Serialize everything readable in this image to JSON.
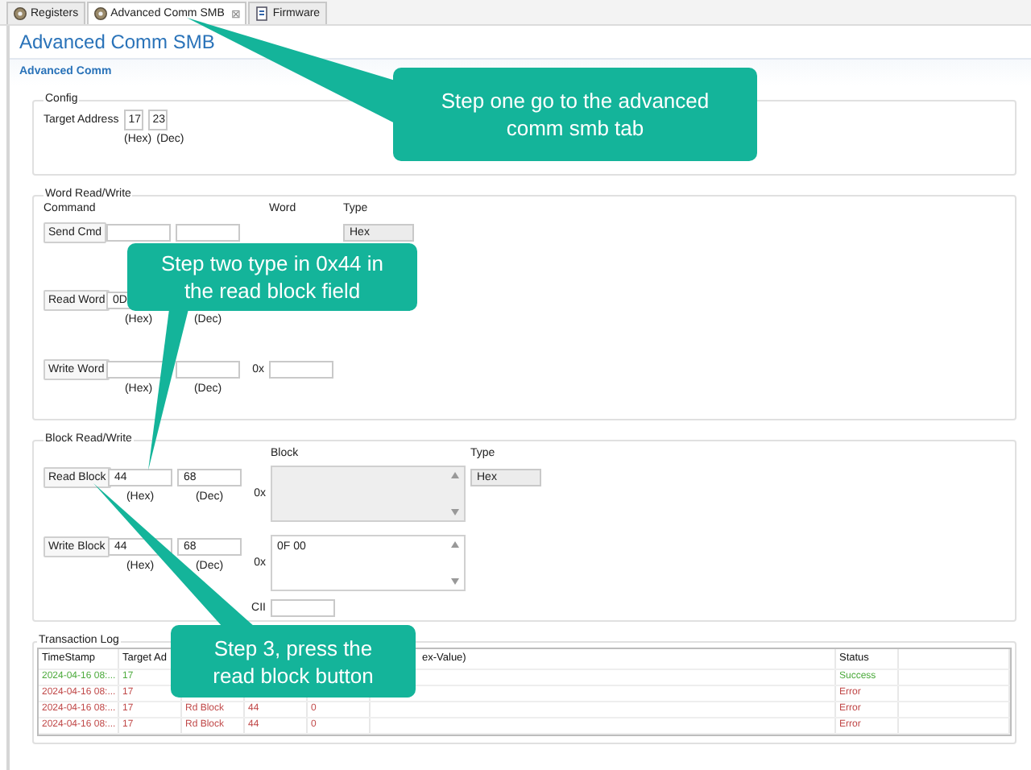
{
  "tabs": [
    {
      "label": "Registers",
      "selected": false
    },
    {
      "label": "Advanced Comm SMB",
      "selected": true,
      "close": "⊠"
    },
    {
      "label": "Firmware",
      "selected": false
    }
  ],
  "header": {
    "title": "Advanced Comm SMB",
    "section": "Advanced Comm"
  },
  "config": {
    "title": "Config",
    "label": "Target Address",
    "hex": "17",
    "dec": "23",
    "hex_caption": "(Hex)",
    "dec_caption": "(Dec)"
  },
  "word_rw": {
    "title": "Word Read/Write",
    "command_heading": "Command",
    "word_heading": "Word",
    "type_heading": "Type",
    "send": {
      "button": "Send Cmd",
      "type": "Hex"
    },
    "read": {
      "button": "Read Word",
      "hex": "0D",
      "hex_caption": "(Hex)",
      "dec_caption": "(Dec)"
    },
    "write": {
      "button": "Write Word",
      "prefix": "0x",
      "hex_caption": "(Hex)",
      "dec_caption": "(Dec)"
    }
  },
  "block_rw": {
    "title": "Block Read/Write",
    "block_heading": "Block",
    "type_heading": "Type",
    "read": {
      "button": "Read Block",
      "hex": "44",
      "dec": "68",
      "hex_caption": "(Hex)",
      "dec_caption": "(Dec)",
      "prefix": "0x",
      "type": "Hex",
      "disabled": true
    },
    "write": {
      "button": "Write Block",
      "hex": "44",
      "dec": "68",
      "hex_caption": "(Hex)",
      "dec_caption": "(Dec)",
      "prefix": "0x",
      "block": "0F 00",
      "disabled": false
    },
    "ascii_label": "CII"
  },
  "log": {
    "title": "Transaction Log",
    "columns": [
      "TimeStamp",
      "Target Ad",
      "",
      "",
      "",
      "ex-Value)",
      "Status"
    ],
    "rows": [
      {
        "kind": "success",
        "timestamp": "2024-04-16 08:...",
        "target": "17",
        "status": "Success"
      },
      {
        "kind": "error",
        "timestamp": "2024-04-16 08:...",
        "target": "17",
        "status": "Error"
      },
      {
        "kind": "error",
        "timestamp": "2024-04-16 08:...",
        "target": "17",
        "column_3": "Rd Block",
        "column_4": "44",
        "column_5": "0",
        "status": "Error"
      },
      {
        "kind": "error",
        "timestamp": "2024-04-16 08:...",
        "target": "17",
        "column_3": "Rd Block",
        "column_4": "44",
        "column_5": "0",
        "status": "Error"
      }
    ]
  },
  "callouts": [
    {
      "text": "Step one go to the advanced comm smb tab"
    },
    {
      "text": "Step two type in 0x44 in the read block field"
    },
    {
      "text": "Step 3, press the read block button"
    }
  ]
}
